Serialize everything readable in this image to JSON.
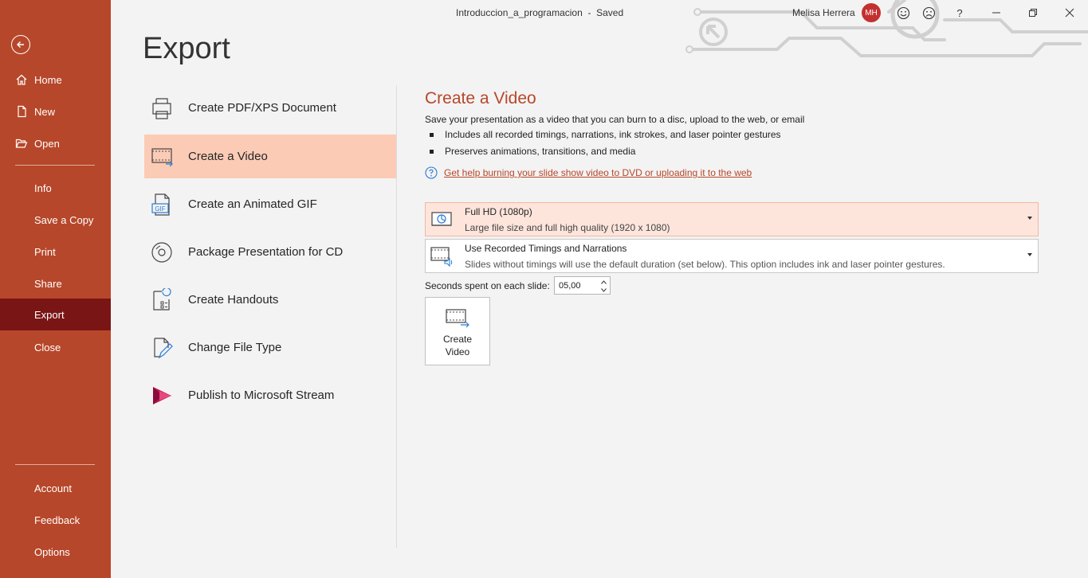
{
  "window": {
    "document_title": "Introduccion_a_programacion",
    "separator": "-",
    "save_status": "Saved",
    "user_name": "Melisa Herrera",
    "user_initials": "MH",
    "help_label": "?"
  },
  "sidebar": {
    "top_items": [
      {
        "label": "Home",
        "icon": "home-icon"
      },
      {
        "label": "New",
        "icon": "new-document-icon"
      },
      {
        "label": "Open",
        "icon": "folder-open-icon"
      }
    ],
    "middle_items": [
      "Info",
      "Save a Copy",
      "Print",
      "Share",
      "Export",
      "Close"
    ],
    "active_item": "Export",
    "bottom_items": [
      "Account",
      "Feedback",
      "Options"
    ]
  },
  "page_title": "Export",
  "export_options": [
    {
      "label": "Create PDF/XPS Document",
      "icon": "pdf-document-icon"
    },
    {
      "label": "Create a Video",
      "icon": "video-icon",
      "selected": true
    },
    {
      "label": "Create an Animated GIF",
      "icon": "gif-icon",
      "icon_text": "GIF"
    },
    {
      "label": "Package Presentation for CD",
      "icon": "cd-icon"
    },
    {
      "label": "Create Handouts",
      "icon": "handouts-icon"
    },
    {
      "label": "Change File Type",
      "icon": "change-file-type-icon"
    },
    {
      "label": "Publish to Microsoft Stream",
      "icon": "stream-icon"
    }
  ],
  "video_pane": {
    "title": "Create a Video",
    "description": "Save your presentation as a video that you can burn to a disc, upload to the web, or email",
    "bullets": [
      "Includes all recorded timings, narrations, ink strokes, and laser pointer gestures",
      "Preserves animations, transitions, and media"
    ],
    "help_link": "Get help burning your slide show video to DVD or uploading it to the web",
    "quality_dropdown": {
      "title": "Full HD (1080p)",
      "subtitle": "Large file size and full high quality (1920 x 1080)"
    },
    "timings_dropdown": {
      "title": "Use Recorded Timings and Narrations",
      "subtitle": "Slides without timings will use the default duration (set below). This option includes ink and laser pointer gestures."
    },
    "seconds_label": "Seconds spent on each slide:",
    "seconds_value": "05,00",
    "create_button_label": "Create Video"
  },
  "colors": {
    "accent": "#b7472a",
    "sidebar_active": "#7a1515",
    "selected_option": "#fccbb5",
    "selected_dropdown": "#fde5dc"
  }
}
